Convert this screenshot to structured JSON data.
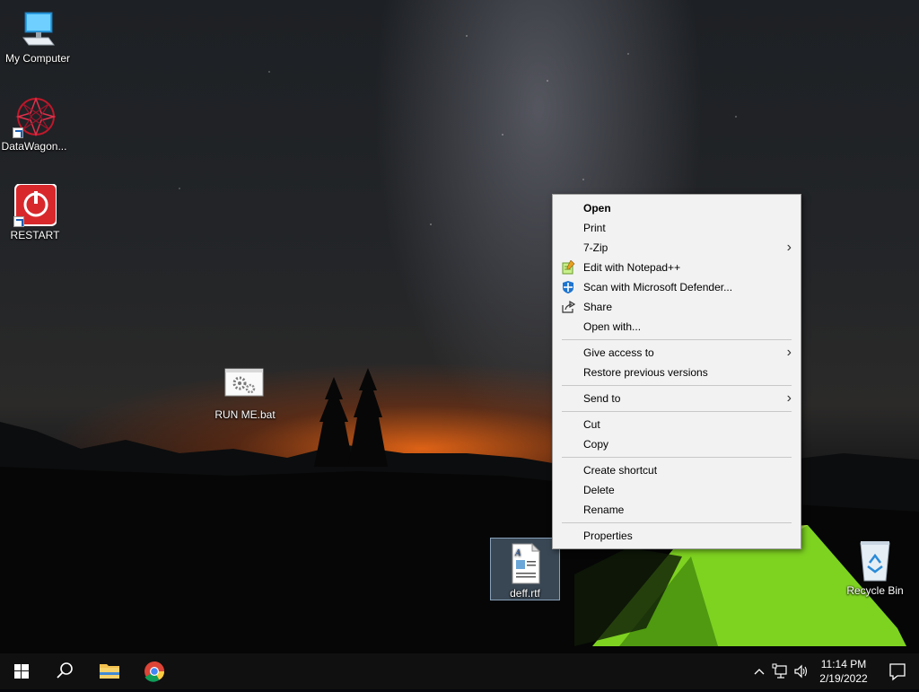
{
  "desktop_icons": {
    "my_computer": "My Computer",
    "datawagon": "DataWagon...",
    "restart": "RESTART",
    "run_me": "RUN ME.bat",
    "deff": "deff.rtf",
    "recycle_bin": "Recycle Bin"
  },
  "context_menu": {
    "open": "Open",
    "print": "Print",
    "zip": "7-Zip",
    "notepad": "Edit with Notepad++",
    "defender": "Scan with Microsoft Defender...",
    "share": "Share",
    "open_with": "Open with...",
    "give_access": "Give access to",
    "restore": "Restore previous versions",
    "send_to": "Send to",
    "cut": "Cut",
    "copy": "Copy",
    "create_shortcut": "Create shortcut",
    "delete": "Delete",
    "rename": "Rename",
    "properties": "Properties"
  },
  "taskbar": {
    "time": "11:14 PM",
    "date": "2/19/2022"
  },
  "colors": {
    "accent": "#1a73e8",
    "menu_bg": "#f2f2f2",
    "taskbar_bg": "#101010"
  }
}
